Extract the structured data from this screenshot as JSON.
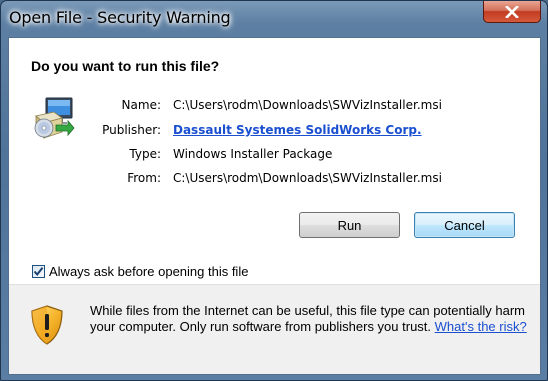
{
  "window": {
    "title": "Open File - Security Warning"
  },
  "question": "Do you want to run this file?",
  "file": {
    "icon": "msi-installer-icon",
    "properties": [
      {
        "label": "Name:",
        "value": "C:\\Users\\rodm\\Downloads\\SWVizInstaller.msi",
        "is_link": false
      },
      {
        "label": "Publisher:",
        "value": "Dassault Systemes SolidWorks Corp.",
        "is_link": true
      },
      {
        "label": "Type:",
        "value": "Windows Installer Package",
        "is_link": false
      },
      {
        "label": "From:",
        "value": "C:\\Users\\rodm\\Downloads\\SWVizInstaller.msi",
        "is_link": false
      }
    ]
  },
  "buttons": {
    "run": "Run",
    "cancel": "Cancel"
  },
  "checkbox": {
    "label": "Always ask before opening this file",
    "checked": true
  },
  "footer": {
    "icon": "security-shield-icon",
    "text": "While files from the Internet can be useful, this file type can potentially harm your computer. Only run software from publishers you trust.",
    "link": "What's the risk?"
  },
  "colors": {
    "link": "#1a4fd0",
    "titlebar": "#5d7fa3",
    "close_button": "#c23b22"
  }
}
